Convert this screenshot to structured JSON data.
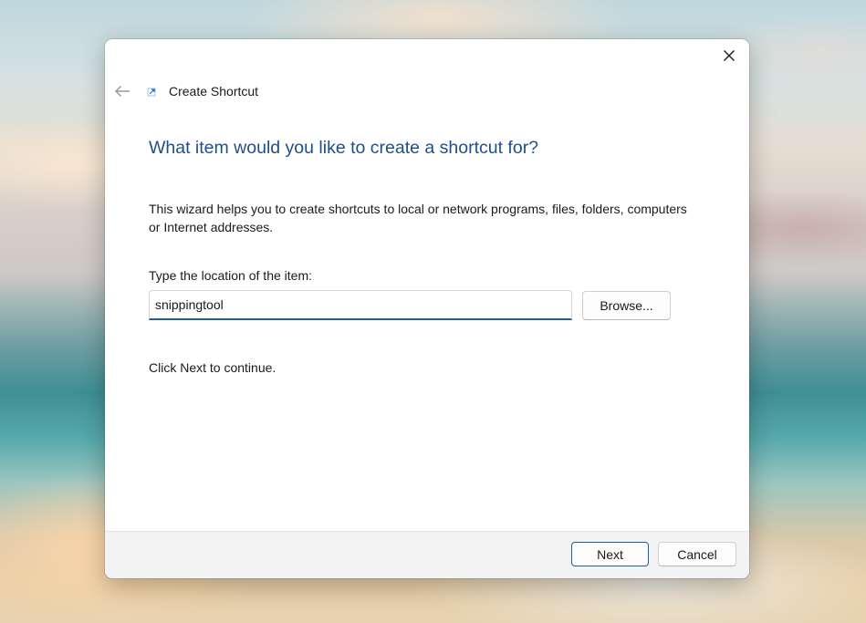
{
  "window": {
    "title": "Create Shortcut",
    "close_label": "×"
  },
  "wizard": {
    "heading": "What item would you like to create a shortcut for?",
    "description": "This wizard helps you to create shortcuts to local or network programs, files, folders, computers or Internet addresses.",
    "location_label": "Type the location of the item:",
    "location_value": "snippingtool",
    "browse_label": "Browse...",
    "continue_text": "Click Next to continue."
  },
  "footer": {
    "next_label": "Next",
    "cancel_label": "Cancel"
  },
  "icons": {
    "back": "back-arrow-icon",
    "app": "shortcut-icon",
    "close": "close-icon"
  },
  "colors": {
    "heading": "#1f4e8c",
    "accent": "#1f5f9a",
    "footer_bg": "#f3f3f3"
  }
}
